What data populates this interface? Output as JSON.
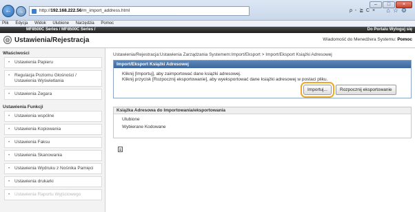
{
  "browser": {
    "url_prefix": "http://",
    "url_host": "192.168.222.56",
    "url_path": "/m_import_address.html",
    "addr_tools": "ρ - ≧ C ×",
    "menu": [
      "Plik",
      "Edycja",
      "Widok",
      "Ulubione",
      "Narzędzia",
      "Pomoc"
    ]
  },
  "header": {
    "model": "MF8500C Series / MF8500C Series /",
    "links": "Do Portalu  Wyloguj się",
    "title": "Ustawienia/Rejestracja",
    "sysmgr_label": "Wiadomość do Menedżera Systemu:",
    "sysmgr_link": "Pomoc"
  },
  "sidebar": {
    "section1": "Właściwości",
    "items1": [
      "Ustawienia Papieru",
      "Regulacja Poziomu Głośności / Ustawienia Wyświetlania",
      "Ustawienia Zegara"
    ],
    "section2": "Ustawienia Funkcji",
    "items2": [
      "Ustawienia wspólne",
      "Ustawienia Kopiowania",
      "Ustawienia Faksu",
      "Ustawienia Skanowania",
      "Ustawienia Wydruku z Nośnika Pamięci",
      "Ustawienia drukarki",
      "Ustawienia Raportu Wyjściowego"
    ]
  },
  "main": {
    "breadcrumb": "Ustawienia/Rejestracja:Ustawienia Zarządzania Systemem:Import/Eksport > Import/Eksport Książki Adresowej",
    "panel_title": "Import/Eksport Książki Adresowej",
    "line1": "Kliknij [Importuj], aby zaimportować dane książki adresowej.",
    "line2": "Kliknij przycisk [Rozpocznij eksportowanie], aby wyeksportować dane książki adresowej w postaci pliku.",
    "import_label": "Importuj...",
    "export_label": "Rozpocznij eksportowanie",
    "book_title": "Książka Adresowa do Importowania/eksportowania",
    "book_items": [
      "Ulubione",
      "Wybierane Kodowane"
    ]
  }
}
